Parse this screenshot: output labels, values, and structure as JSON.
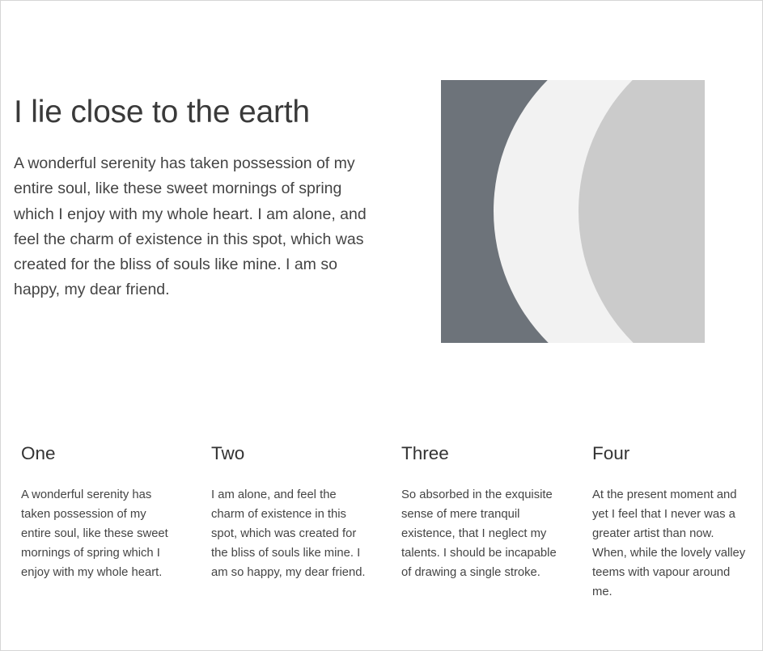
{
  "hero": {
    "title": "I lie close to the earth",
    "text": "A wonderful serenity has taken possession of my entire soul, like these sweet mornings of spring which I enjoy with my whole heart. I am alone, and feel the charm of existence in this spot, which was created for the bliss of souls like mine. I am so happy, my dear friend.",
    "art_colors": {
      "background": "#6d737a",
      "front_shape": "#f2f2f2",
      "back_shape": "#cbcbcb"
    }
  },
  "features": [
    {
      "title": "One",
      "text": "A wonderful serenity has taken possession of my entire soul, like these sweet mornings of spring which I enjoy with my whole heart."
    },
    {
      "title": "Two",
      "text": "I am alone, and feel the charm of existence in this spot, which was created for the bliss of souls like mine. I am so happy, my dear friend."
    },
    {
      "title": "Three",
      "text": "So absorbed in the exquisite sense of mere tranquil existence, that I neglect my talents. I should be incapable of drawing a single stroke."
    },
    {
      "title": "Four",
      "text": "At the present moment and yet I feel that I never was a greater artist than now. When, while the lovely valley teems with vapour around me."
    }
  ]
}
